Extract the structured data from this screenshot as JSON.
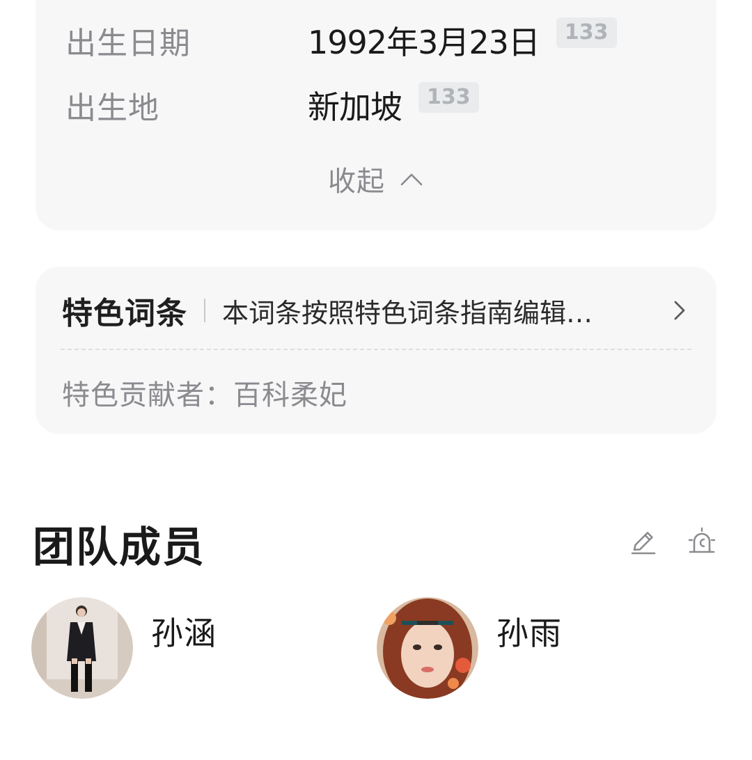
{
  "info": {
    "rows": [
      {
        "label": "出生日期",
        "value": "1992年3月23日",
        "badge": "133"
      },
      {
        "label": "出生地",
        "value": "新加坡",
        "badge": "133"
      }
    ],
    "collapse_label": "收起"
  },
  "feature": {
    "title": "特色词条",
    "description": "本词条按照特色词条指南编辑…",
    "contributor": "特色贡献者：百科柔妃"
  },
  "team": {
    "title": "团队成员",
    "members": [
      {
        "name": "孙涵"
      },
      {
        "name": "孙雨"
      }
    ]
  },
  "icons": {
    "collapse": "chevron-up-icon",
    "feature_arrow": "chevron-right-icon",
    "edit": "pencil-icon",
    "report": "alarm-icon"
  },
  "colors": {
    "card_bg": "#f7f7f8",
    "badge_bg": "#eaebed",
    "badge_text": "#b0b3b8",
    "muted_text": "#8a8a8f"
  }
}
